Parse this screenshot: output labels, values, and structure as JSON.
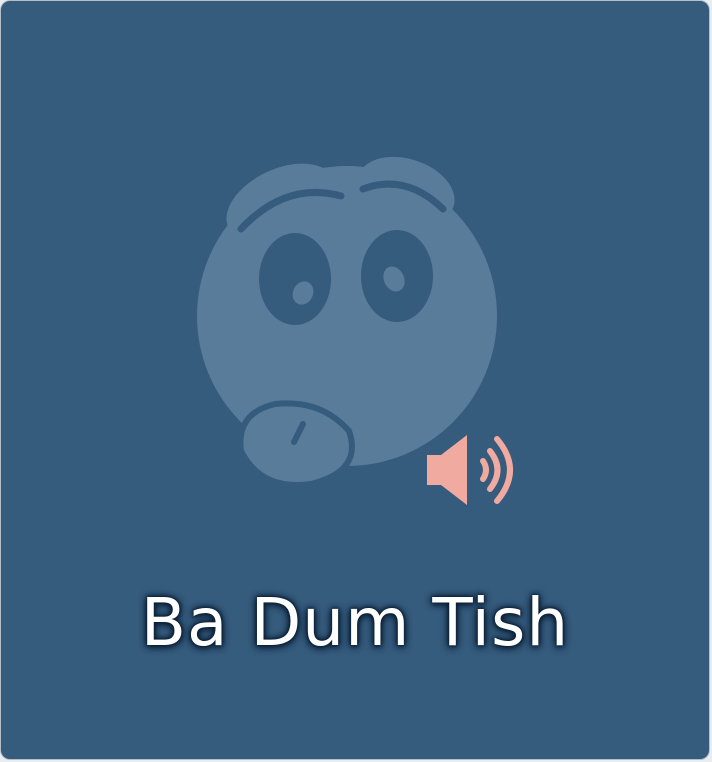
{
  "tile": {
    "label": "Ba Dum Tish",
    "icon": "goofy-face-icon",
    "audio_icon": "speaker-icon"
  },
  "colors": {
    "background": "#355B7D",
    "face": "#5A7C9B",
    "face_features": "#355B7D",
    "speaker": "#F0AAA0",
    "label_text": "#FFFFFF",
    "label_glow": "#0A1E34"
  }
}
